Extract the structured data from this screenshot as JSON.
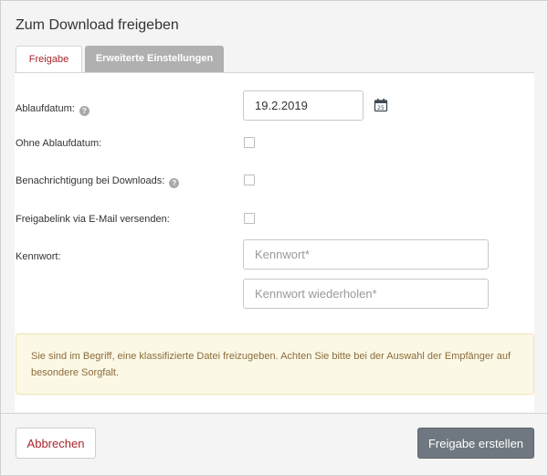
{
  "dialog": {
    "title": "Zum Download freigeben"
  },
  "tabs": [
    {
      "label": "Freigabe",
      "active": true
    },
    {
      "label": "Erweiterte Einstellungen",
      "active": false
    }
  ],
  "form": {
    "expiry_label": "Ablaufdatum:",
    "expiry_value": "19.2.2019",
    "no_expiry_label": "Ohne Ablaufdatum:",
    "notify_label": "Benachrichtigung bei Downloads:",
    "email_link_label": "Freigabelink via E-Mail versenden:",
    "password_label": "Kennwort:",
    "password_placeholder": "Kennwort*",
    "password_repeat_placeholder": "Kennwort wiederholen*",
    "help_icon_glyph": "?",
    "help_icon": "question-circle-icon",
    "calendar_icon": "calendar-icon",
    "calendar_day": "25"
  },
  "warning": {
    "text": "Sie sind im Begriff, eine klassifizierte Datei freizugeben. Achten Sie bitte bei der Auswahl der Empfänger auf besondere Sorgfalt."
  },
  "footer": {
    "cancel_label": "Abbrechen",
    "submit_label": "Freigabe erstellen"
  },
  "colors": {
    "accent": "#a8262c",
    "primary_button": "#6f7880",
    "warning_bg": "#fcf8e6",
    "warning_text": "#8a6d3b"
  }
}
